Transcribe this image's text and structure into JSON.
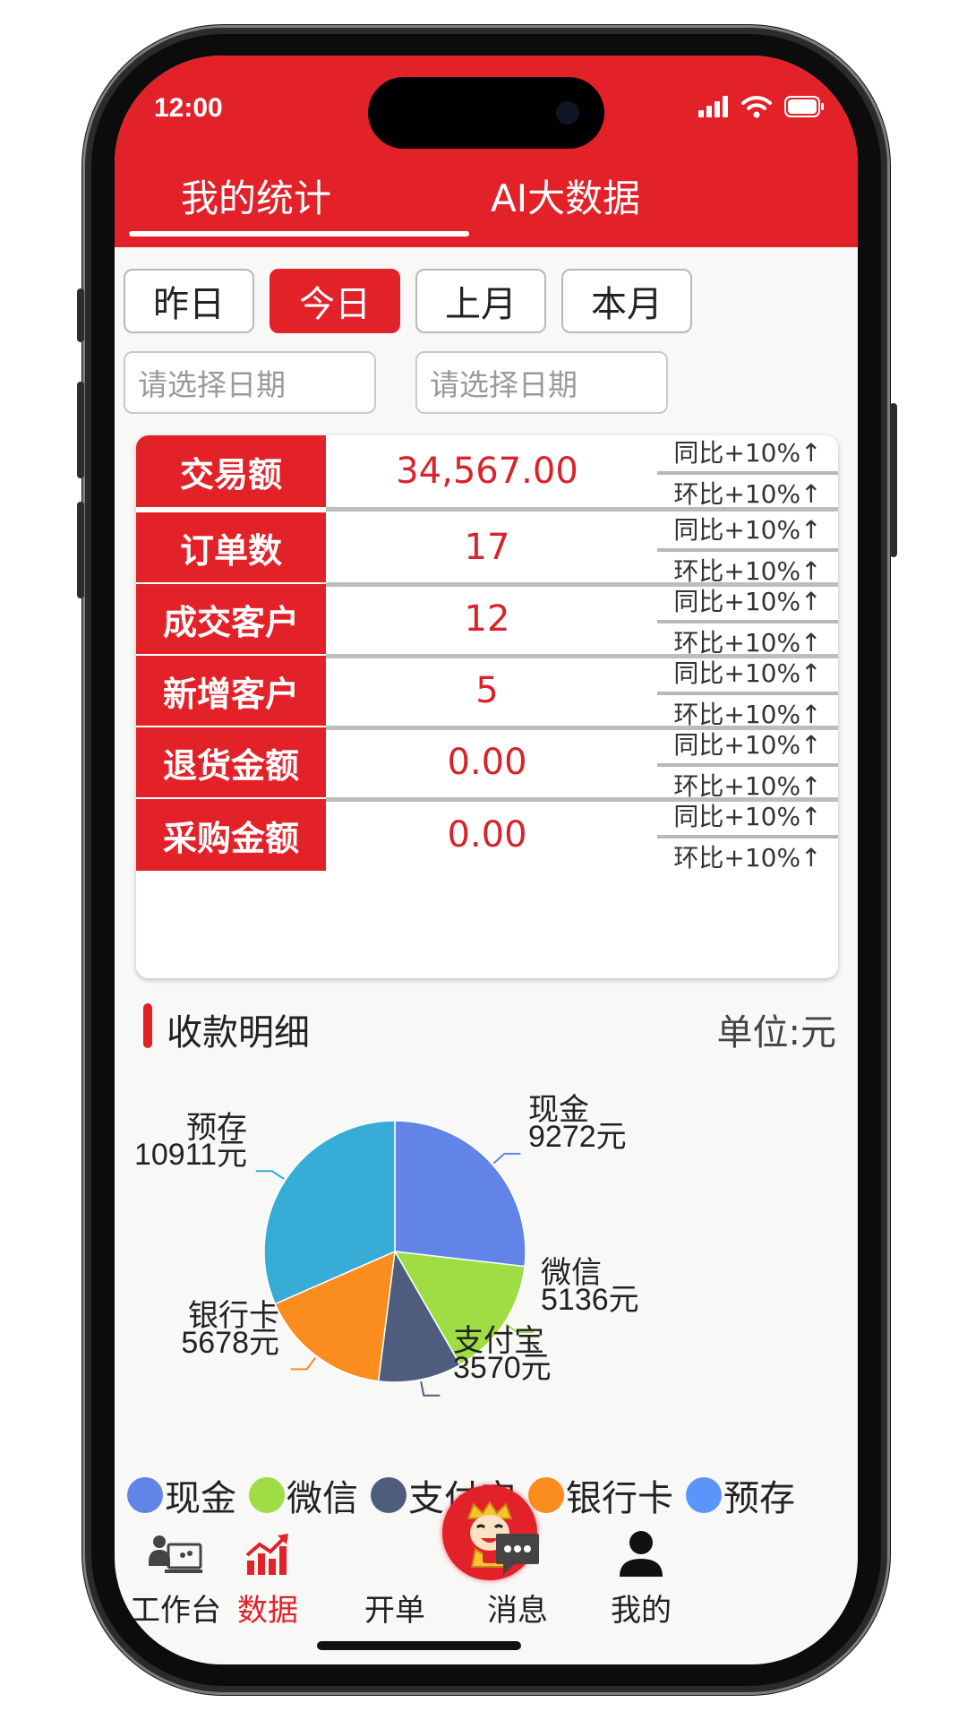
{
  "status": {
    "time": "12:00"
  },
  "tabs": [
    {
      "label": "我的统计",
      "active": true
    },
    {
      "label": "AI大数据",
      "active": false
    }
  ],
  "date_filters": [
    {
      "label": "昨日",
      "active": false
    },
    {
      "label": "今日",
      "active": true
    },
    {
      "label": "上月",
      "active": false
    },
    {
      "label": "本月",
      "active": false
    }
  ],
  "date_range": {
    "start_placeholder": "请选择日期",
    "end_placeholder": "请选择日期"
  },
  "stats": [
    {
      "label": "交易额",
      "value": "34,567.00",
      "yoy": "同比+10%↑",
      "mom": "环比+10%↑"
    },
    {
      "label": "订单数",
      "value": "17",
      "yoy": "同比+10%↑",
      "mom": "环比+10%↑"
    },
    {
      "label": "成交客户",
      "value": "12",
      "yoy": "同比+10%↑",
      "mom": "环比+10%↑"
    },
    {
      "label": "新增客户",
      "value": "5",
      "yoy": "同比+10%↑",
      "mom": "环比+10%↑"
    },
    {
      "label": "退货金额",
      "value": "0.00",
      "yoy": "同比+10%↑",
      "mom": "环比+10%↑"
    },
    {
      "label": "采购金额",
      "value": "0.00",
      "yoy": "同比+10%↑",
      "mom": "环比+10%↑"
    }
  ],
  "section": {
    "title": "收款明细",
    "unit": "单位:元"
  },
  "chart_data": {
    "type": "pie",
    "slices": [
      {
        "name": "现金",
        "value": 9272,
        "label": "9272元",
        "color": "#6283e8"
      },
      {
        "name": "微信",
        "value": 5136,
        "label": "5136元",
        "color": "#9fdd44"
      },
      {
        "name": "支付宝",
        "value": 3570,
        "label": "3570元",
        "color": "#4e5d7d"
      },
      {
        "name": "银行卡",
        "value": 5678,
        "label": "5678元",
        "color": "#fb8c1e"
      },
      {
        "name": "预存",
        "value": 10911,
        "label": "10911元",
        "color": "#36acd6"
      }
    ],
    "legend": [
      {
        "name": "现金",
        "color": "#6283e8"
      },
      {
        "name": "微信",
        "color": "#9fdd44"
      },
      {
        "name": "支付宝",
        "color": "#4e5d7d"
      },
      {
        "name": "银行卡",
        "color": "#fb8c1e"
      },
      {
        "name": "预存",
        "color": "#5b95fb"
      }
    ],
    "legend_placement": "bottom"
  },
  "nav": [
    {
      "label": "工作台",
      "icon": "workbench-icon",
      "active": false
    },
    {
      "label": "数据",
      "icon": "chart-icon",
      "active": true
    },
    {
      "label": "开单",
      "icon": "mascot-icon",
      "active": false
    },
    {
      "label": "消息",
      "icon": "message-icon",
      "active": false
    },
    {
      "label": "我的",
      "icon": "user-icon",
      "active": false
    }
  ],
  "colors": {
    "brand": "#e32129",
    "value_text": "#d8232a",
    "background": "#f8f8f7"
  }
}
